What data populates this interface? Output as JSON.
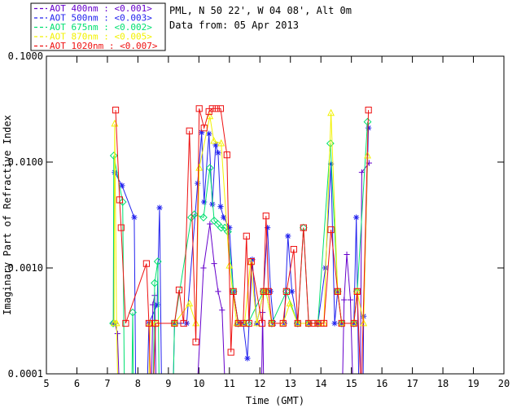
{
  "header": {
    "site": "PML, N 50 22', W 04 08', Alt 0m",
    "date": "Data from: 05 Apr 2013"
  },
  "colors": {
    "frame": "#000000",
    "text": "#000000",
    "background": "#ffffff"
  },
  "chart_data": {
    "type": "line",
    "xlabel": "Time (GMT)",
    "ylabel": "Imaginary Part of Refractive Index",
    "xlim": [
      5,
      20
    ],
    "ylim": [
      0.0001,
      0.1
    ],
    "yscale": "log",
    "grid": false,
    "xticks": [
      5,
      6,
      7,
      8,
      9,
      10,
      11,
      12,
      13,
      14,
      15,
      16,
      17,
      18,
      19,
      20
    ],
    "yticks": [
      0.0001,
      0.001,
      0.01,
      0.1
    ],
    "ytick_labels": [
      "0.0001",
      "0.0010",
      "0.0100",
      "0.1000"
    ],
    "legend": {
      "position": "top-left",
      "border": true,
      "line_style": "dashed"
    },
    "series": [
      {
        "name": "AOT  400nm",
        "legend_value": "<0.001>",
        "wavelength_nm": 400,
        "color": "#6600cc",
        "marker": "plus",
        "points": [
          [
            7.25,
            0.0003
          ],
          [
            7.33,
            0.00024
          ],
          [
            7.4,
            6e-05
          ],
          [
            8.44,
            6e-05
          ],
          [
            8.49,
            0.00045
          ],
          [
            8.55,
            0.00055
          ],
          [
            8.6,
            6e-05
          ],
          [
            9.93,
            6e-05
          ],
          [
            10.15,
            0.001
          ],
          [
            10.36,
            0.0026
          ],
          [
            10.5,
            0.0011
          ],
          [
            10.63,
            0.0006
          ],
          [
            10.76,
            0.0004
          ],
          [
            10.87,
            6e-05
          ],
          [
            12.05,
            6e-05
          ],
          [
            12.09,
            0.00038
          ],
          [
            12.13,
            6e-05
          ],
          [
            14.7,
            6e-05
          ],
          [
            14.76,
            0.0005
          ],
          [
            14.85,
            0.00134
          ],
          [
            14.97,
            0.0005
          ],
          [
            15.06,
            6e-05
          ],
          [
            15.29,
            6e-05
          ],
          [
            15.34,
            0.008
          ],
          [
            15.58,
            0.0098
          ]
        ]
      },
      {
        "name": "AOT  500nm",
        "legend_value": "<0.003>",
        "wavelength_nm": 500,
        "color": "#2222ee",
        "marker": "asterisk",
        "points": [
          [
            7.2,
            0.0003
          ],
          [
            7.24,
            0.008
          ],
          [
            7.48,
            0.006
          ],
          [
            7.88,
            0.003
          ],
          [
            7.93,
            6e-05
          ],
          [
            8.3,
            6e-05
          ],
          [
            8.36,
            0.0003
          ],
          [
            8.63,
            0.00045
          ],
          [
            8.71,
            0.0037
          ],
          [
            8.78,
            6e-05
          ],
          [
            9.15,
            6e-05
          ],
          [
            9.2,
            0.0003
          ],
          [
            9.6,
            0.0003
          ],
          [
            9.96,
            0.0063
          ],
          [
            10.09,
            0.019
          ],
          [
            10.17,
            0.0042
          ],
          [
            10.33,
            0.0185
          ],
          [
            10.44,
            0.004
          ],
          [
            10.55,
            0.0145
          ],
          [
            10.63,
            0.0122
          ],
          [
            10.71,
            0.0038
          ],
          [
            10.81,
            0.003
          ],
          [
            11.0,
            0.0024
          ],
          [
            11.13,
            0.0006
          ],
          [
            11.29,
            0.0003
          ],
          [
            11.45,
            0.0003
          ],
          [
            11.59,
            0.00014
          ],
          [
            11.75,
            0.0012
          ],
          [
            11.9,
            0.0003
          ],
          [
            12.12,
            0.0006
          ],
          [
            12.25,
            0.0024
          ],
          [
            12.35,
            0.0006
          ],
          [
            12.45,
            0.0003
          ],
          [
            12.8,
            0.0003
          ],
          [
            12.92,
            0.002
          ],
          [
            13.05,
            0.0006
          ],
          [
            13.24,
            0.0003
          ],
          [
            13.6,
            0.0003
          ],
          [
            13.9,
            0.0003
          ],
          [
            14.15,
            0.001
          ],
          [
            14.33,
            0.0096
          ],
          [
            14.45,
            0.0003
          ],
          [
            14.55,
            0.0006
          ],
          [
            14.68,
            0.0003
          ],
          [
            15.08,
            0.0003
          ],
          [
            15.16,
            0.003
          ],
          [
            15.25,
            6e-05
          ],
          [
            15.38,
            6e-05
          ],
          [
            15.4,
            0.00035
          ],
          [
            15.56,
            0.021
          ]
        ]
      },
      {
        "name": "AOT  675nm",
        "legend_value": "<0.002>",
        "wavelength_nm": 675,
        "color": "#00e070",
        "marker": "diamond",
        "points": [
          [
            7.19,
            0.0003
          ],
          [
            7.21,
            0.0115
          ],
          [
            7.5,
            0.0042
          ],
          [
            7.56,
            6e-05
          ],
          [
            7.8,
            6e-05
          ],
          [
            7.83,
            0.00038
          ],
          [
            7.86,
            6e-05
          ],
          [
            8.5,
            6e-05
          ],
          [
            8.55,
            0.00072
          ],
          [
            8.65,
            0.00115
          ],
          [
            8.7,
            6e-05
          ],
          [
            9.15,
            6e-05
          ],
          [
            9.2,
            0.0003
          ],
          [
            9.75,
            0.003
          ],
          [
            9.85,
            0.0032
          ],
          [
            10.15,
            0.003
          ],
          [
            10.36,
            0.0088
          ],
          [
            10.5,
            0.0028
          ],
          [
            10.62,
            0.0026
          ],
          [
            10.73,
            0.0024
          ],
          [
            10.85,
            0.0024
          ],
          [
            10.95,
            0.0022
          ],
          [
            11.13,
            0.0006
          ],
          [
            11.29,
            0.0003
          ],
          [
            11.61,
            0.0003
          ],
          [
            12.12,
            0.0006
          ],
          [
            12.2,
            0.0006
          ],
          [
            12.39,
            0.0003
          ],
          [
            12.87,
            0.0006
          ],
          [
            13.24,
            0.0003
          ],
          [
            13.43,
            0.0024
          ],
          [
            13.6,
            0.0003
          ],
          [
            13.9,
            0.0003
          ],
          [
            14.31,
            0.015
          ],
          [
            14.55,
            0.0006
          ],
          [
            14.68,
            0.0003
          ],
          [
            15.08,
            0.0003
          ],
          [
            15.19,
            0.0006
          ],
          [
            15.53,
            0.024
          ]
        ]
      },
      {
        "name": "AOT  870nm",
        "legend_value": "<0.005>",
        "wavelength_nm": 870,
        "color": "#f2f200",
        "marker": "triangle",
        "points": [
          [
            7.22,
            0.0003
          ],
          [
            7.24,
            0.023
          ],
          [
            7.3,
            0.0003
          ],
          [
            7.35,
            6e-05
          ],
          [
            8.35,
            6e-05
          ],
          [
            8.4,
            0.0003
          ],
          [
            8.6,
            0.0003
          ],
          [
            9.2,
            0.0003
          ],
          [
            9.69,
            0.00046
          ],
          [
            9.9,
            0.0003
          ],
          [
            10.01,
            0.0088
          ],
          [
            10.36,
            0.027
          ],
          [
            10.49,
            0.0158
          ],
          [
            10.73,
            0.015
          ],
          [
            11.0,
            0.00105
          ],
          [
            11.24,
            0.0003
          ],
          [
            11.5,
            0.0003
          ],
          [
            11.69,
            0.00113
          ],
          [
            11.9,
            0.0003
          ],
          [
            12.12,
            0.0006
          ],
          [
            12.2,
            0.0006
          ],
          [
            12.39,
            0.0003
          ],
          [
            12.76,
            0.0003
          ],
          [
            12.98,
            0.00046
          ],
          [
            13.24,
            0.0003
          ],
          [
            13.6,
            0.0003
          ],
          [
            13.9,
            0.0003
          ],
          [
            14.1,
            0.0003
          ],
          [
            14.33,
            0.029
          ],
          [
            14.55,
            0.0006
          ],
          [
            14.68,
            0.0003
          ],
          [
            15.08,
            0.0003
          ],
          [
            15.19,
            0.0006
          ],
          [
            15.4,
            0.0003
          ],
          [
            15.53,
            0.0115
          ]
        ]
      },
      {
        "name": "AOT 1020nm",
        "legend_value": "<0.007>",
        "wavelength_nm": 1020,
        "color": "#ee1111",
        "marker": "square",
        "points": [
          [
            7.27,
            0.031
          ],
          [
            7.4,
            0.0044
          ],
          [
            7.45,
            0.0024
          ],
          [
            7.6,
            0.0003
          ],
          [
            8.28,
            0.0011
          ],
          [
            8.36,
            0.0003
          ],
          [
            8.43,
            6e-05
          ],
          [
            8.5,
            6e-05
          ],
          [
            8.58,
            0.0003
          ],
          [
            9.2,
            0.0003
          ],
          [
            9.35,
            0.00062
          ],
          [
            9.5,
            0.0003
          ],
          [
            9.69,
            0.0197
          ],
          [
            9.9,
            0.0002
          ],
          [
            10.01,
            0.032
          ],
          [
            10.17,
            0.021
          ],
          [
            10.33,
            0.03
          ],
          [
            10.44,
            0.032
          ],
          [
            10.57,
            0.032
          ],
          [
            10.71,
            0.032
          ],
          [
            10.92,
            0.0117
          ],
          [
            11.05,
            0.00016
          ],
          [
            11.13,
            0.0006
          ],
          [
            11.29,
            0.0003
          ],
          [
            11.45,
            0.0003
          ],
          [
            11.56,
            0.002
          ],
          [
            11.64,
            0.0003
          ],
          [
            11.72,
            0.00115
          ],
          [
            12.07,
            0.0003
          ],
          [
            12.12,
            0.0006
          ],
          [
            12.2,
            0.0031
          ],
          [
            12.28,
            0.0006
          ],
          [
            12.39,
            0.0003
          ],
          [
            12.76,
            0.0003
          ],
          [
            12.87,
            0.0006
          ],
          [
            13.11,
            0.0015
          ],
          [
            13.24,
            0.0003
          ],
          [
            13.43,
            0.0024
          ],
          [
            13.6,
            0.0003
          ],
          [
            13.75,
            0.0003
          ],
          [
            13.9,
            0.0003
          ],
          [
            14.0,
            0.0003
          ],
          [
            14.1,
            0.0003
          ],
          [
            14.33,
            0.0023
          ],
          [
            14.55,
            0.0006
          ],
          [
            14.68,
            0.0003
          ],
          [
            15.08,
            0.0003
          ],
          [
            15.19,
            0.0006
          ],
          [
            15.32,
            6e-05
          ],
          [
            15.56,
            0.031
          ]
        ]
      }
    ]
  }
}
